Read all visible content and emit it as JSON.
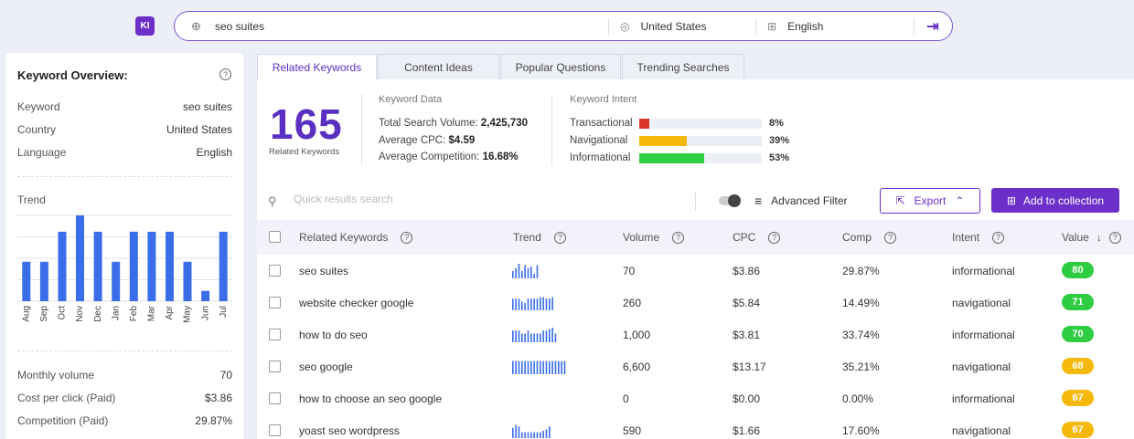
{
  "logo": "KI",
  "search": {
    "query": "seo suites",
    "location": "United States",
    "language": "English"
  },
  "overview": {
    "title": "Keyword Overview:",
    "rows": [
      {
        "label": "Keyword",
        "value": "seo suites"
      },
      {
        "label": "Country",
        "value": "United States"
      },
      {
        "label": "Language",
        "value": "English"
      }
    ],
    "trend_label": "Trend",
    "trend_months": [
      "Aug",
      "Sep",
      "Oct",
      "Nov",
      "Dec",
      "Jan",
      "Feb",
      "Mar",
      "Apr",
      "May",
      "Jun",
      "Jul"
    ],
    "trend_values": [
      46,
      46,
      81,
      100,
      81,
      46,
      81,
      81,
      81,
      46,
      12,
      81
    ],
    "stats": [
      {
        "label": "Monthly volume",
        "value": "70"
      },
      {
        "label": "Cost per click (Paid)",
        "value": "$3.86"
      },
      {
        "label": "Competition (Paid)",
        "value": "29.87%"
      }
    ]
  },
  "tabs": [
    "Related Keywords",
    "Content Ideas",
    "Popular Questions",
    "Trending Searches"
  ],
  "summary": {
    "count": "165",
    "count_label": "Related Keywords",
    "data_heading": "Keyword Data",
    "data": [
      {
        "label": "Total Search Volume:",
        "value": "2,425,730"
      },
      {
        "label": "Average CPC:",
        "value": "$4.59"
      },
      {
        "label": "Average Competition:",
        "value": "16.68%"
      }
    ],
    "intent_heading": "Keyword Intent",
    "intent": [
      {
        "label": "Transactional",
        "pct": "8%",
        "fill": 0.08,
        "color": "#d9352b"
      },
      {
        "label": "Navigational",
        "pct": "39%",
        "fill": 0.39,
        "color": "#f5b90c"
      },
      {
        "label": "Informational",
        "pct": "53%",
        "fill": 0.53,
        "color": "#2ecc40"
      }
    ]
  },
  "toolbar": {
    "search_placeholder": "Quick results search",
    "advanced_filter": "Advanced Filter",
    "export": "Export",
    "add_collection": "Add to collection"
  },
  "table": {
    "headers": [
      "Related Keywords",
      "Trend",
      "Volume",
      "CPC",
      "Comp",
      "Intent",
      "Value"
    ],
    "rows": [
      {
        "keyword": "seo suites",
        "trend": [
          5,
          7,
          10,
          5,
          9,
          7,
          8,
          3,
          9
        ],
        "volume": "70",
        "cpc": "$3.86",
        "comp": "29.87%",
        "intent": "informational",
        "value": "80",
        "color": "#2ecc40"
      },
      {
        "keyword": "website checker google",
        "trend": [
          8,
          8,
          8,
          6,
          5,
          8,
          8,
          8,
          8,
          9,
          9,
          8,
          8,
          9
        ],
        "volume": "260",
        "cpc": "$5.84",
        "comp": "14.49%",
        "intent": "navigational",
        "value": "71",
        "color": "#2ecc40"
      },
      {
        "keyword": "how to do seo",
        "trend": [
          8,
          8,
          8,
          6,
          6,
          8,
          6,
          6,
          6,
          6,
          8,
          8,
          9,
          10,
          6
        ],
        "volume": "1,000",
        "cpc": "$3.81",
        "comp": "33.74%",
        "intent": "informational",
        "value": "70",
        "color": "#2ecc40"
      },
      {
        "keyword": "seo google",
        "trend": [
          9,
          9,
          9,
          9,
          9,
          9,
          9,
          9,
          9,
          9,
          9,
          9,
          9,
          9,
          9,
          9,
          9,
          9
        ],
        "volume": "6,600",
        "cpc": "$13.17",
        "comp": "35.21%",
        "intent": "navigational",
        "value": "68",
        "color": "#f5b90c"
      },
      {
        "keyword": "how to choose an seo google",
        "trend": [],
        "volume": "0",
        "cpc": "$0.00",
        "comp": "0.00%",
        "intent": "informational",
        "value": "67",
        "color": "#f5b90c"
      },
      {
        "keyword": "yoast seo wordpress",
        "trend": [
          7,
          9,
          8,
          4,
          4,
          4,
          4,
          4,
          4,
          4,
          5,
          6,
          8
        ],
        "volume": "590",
        "cpc": "$1.66",
        "comp": "17.60%",
        "intent": "navigational",
        "value": "67",
        "color": "#f5b90c"
      }
    ]
  }
}
